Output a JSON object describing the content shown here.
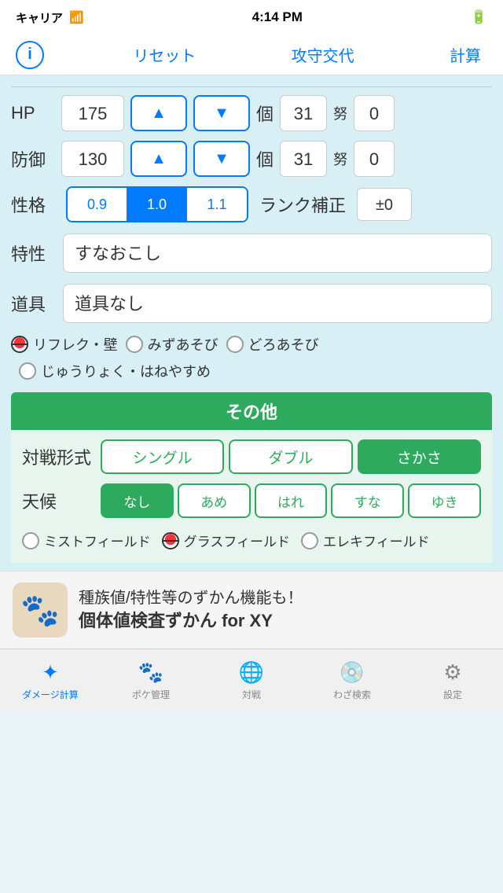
{
  "status_bar": {
    "carrier": "キャリア",
    "time": "4:14 PM",
    "battery": "■■■"
  },
  "toolbar": {
    "info_icon": "i",
    "reset": "リセット",
    "switch": "攻守交代",
    "calc": "計算"
  },
  "hp_row": {
    "label": "HP",
    "value": "175",
    "iv_label": "個",
    "iv_value": "31",
    "ev_label": "努",
    "ev_value": "0"
  },
  "def_row": {
    "label": "防御",
    "value": "130",
    "iv_label": "個",
    "iv_value": "31",
    "ev_label": "努",
    "ev_value": "0"
  },
  "nature_row": {
    "label": "性格",
    "options": [
      "0.9",
      "1.0",
      "1.1"
    ],
    "active_index": 1,
    "rank_label": "ランク補正",
    "rank_value": "±0"
  },
  "ability_row": {
    "label": "特性",
    "value": "すなおこし"
  },
  "item_row": {
    "label": "道具",
    "value": "道具なし"
  },
  "conditions": {
    "item1": "リフレク・壁",
    "item1_selected": true,
    "item2": "みずあそび",
    "item2_selected": false,
    "item3": "どろあそび",
    "item3_selected": false,
    "item4": "じゅうりょく・はねやすめ",
    "item4_selected": false
  },
  "sonota": {
    "header": "その他",
    "battle_label": "対戦形式",
    "battle_options": [
      "シングル",
      "ダブル",
      "さかさ"
    ],
    "battle_active": 2,
    "weather_label": "天候",
    "weather_options": [
      "なし",
      "あめ",
      "はれ",
      "すな",
      "ゆき"
    ],
    "weather_active": 0,
    "field_item1": "ミストフィールド",
    "field_item1_selected": false,
    "field_item2": "グラスフィールド",
    "field_item2_selected": true,
    "field_item3": "エレキフィールド",
    "field_item3_selected": false
  },
  "banner": {
    "text1": "種族値/特性等のずかん機能も！",
    "text2": "個体値検査ずかん for XY"
  },
  "tabs": [
    {
      "label": "ダメージ計算",
      "icon": "⚙",
      "active": true
    },
    {
      "label": "ポケ管理",
      "icon": "🐾",
      "active": false
    },
    {
      "label": "対戦",
      "icon": "🌐",
      "active": false
    },
    {
      "label": "わざ検索",
      "icon": "💿",
      "active": false
    },
    {
      "label": "設定",
      "icon": "⚙",
      "active": false
    }
  ]
}
